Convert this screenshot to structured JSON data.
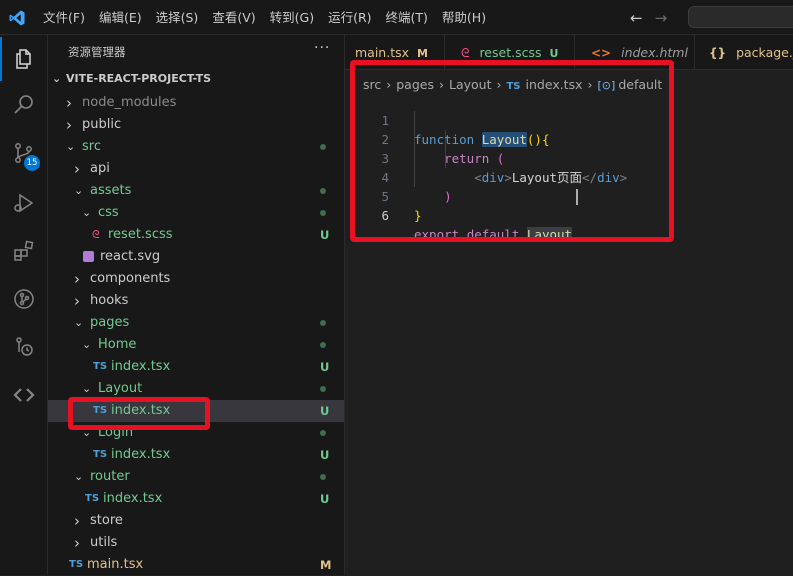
{
  "titlebar": {
    "menu": [
      "文件(F)",
      "编辑(E)",
      "选择(S)",
      "查看(V)",
      "转到(G)",
      "运行(R)",
      "终端(T)",
      "帮助(H)"
    ]
  },
  "activity": {
    "scm_badge": "15"
  },
  "sidebar": {
    "title": "资源管理器",
    "more": "···",
    "project": "VITE-REACT-PROJECT-TS",
    "tree": [
      {
        "name": "node_modules",
        "type": "folder",
        "expanded": false,
        "color": "#8b8b8b"
      },
      {
        "name": "public",
        "type": "folder",
        "expanded": false,
        "color": "#cccccc"
      },
      {
        "name": "src",
        "type": "folder",
        "expanded": true,
        "color": "#73c991"
      },
      {
        "name": "api",
        "type": "folder",
        "expanded": false,
        "color": "#cccccc"
      },
      {
        "name": "assets",
        "type": "folder",
        "expanded": true,
        "color": "#73c991"
      },
      {
        "name": "css",
        "type": "folder",
        "expanded": true,
        "color": "#73c991"
      },
      {
        "name": "reset.scss",
        "type": "scss",
        "color": "#73c991",
        "status": "U"
      },
      {
        "name": "react.svg",
        "type": "svg",
        "color": "#cccccc"
      },
      {
        "name": "components",
        "type": "folder",
        "expanded": false,
        "color": "#cccccc"
      },
      {
        "name": "hooks",
        "type": "folder",
        "expanded": false,
        "color": "#cccccc"
      },
      {
        "name": "pages",
        "type": "folder",
        "expanded": true,
        "color": "#73c991"
      },
      {
        "name": "Home",
        "type": "folder",
        "expanded": true,
        "color": "#73c991"
      },
      {
        "name": "index.tsx",
        "type": "ts",
        "color": "#73c991",
        "status": "U"
      },
      {
        "name": "Layout",
        "type": "folder",
        "expanded": true,
        "color": "#73c991"
      },
      {
        "name": "index.tsx",
        "type": "ts",
        "color": "#73c991",
        "status": "U",
        "selected": true
      },
      {
        "name": "Login",
        "type": "folder",
        "expanded": true,
        "color": "#73c991"
      },
      {
        "name": "index.tsx",
        "type": "ts",
        "color": "#73c991",
        "status": "U"
      },
      {
        "name": "router",
        "type": "folder",
        "expanded": true,
        "color": "#73c991"
      },
      {
        "name": "index.tsx",
        "type": "ts",
        "color": "#73c991",
        "status": "U"
      },
      {
        "name": "store",
        "type": "folder",
        "expanded": false,
        "color": "#cccccc"
      },
      {
        "name": "utils",
        "type": "folder",
        "expanded": false,
        "color": "#cccccc"
      },
      {
        "name": "main.tsx",
        "type": "ts",
        "color": "#e2c08d",
        "status": "M"
      }
    ]
  },
  "tabs": [
    {
      "label": "main.tsx",
      "status": "M",
      "icon": "ts-icon",
      "status_color": "#e2c08d",
      "label_color": "#e2c08d"
    },
    {
      "label": "reset.scss",
      "status": "U",
      "icon": "scss-icon",
      "status_color": "#73c991",
      "label_color": "#73c991"
    },
    {
      "label": "index.html",
      "icon": "html-icon",
      "label_color": "#9d9d9d"
    },
    {
      "label": "package.json",
      "icon": "json-icon",
      "label_color": "#e2c08d"
    }
  ],
  "breadcrumb": {
    "parts": [
      "src",
      "pages",
      "Layout"
    ],
    "file_icon": "TS",
    "file": "index.tsx",
    "symbol": "default"
  },
  "code": {
    "line_numbers": [
      "1",
      "2",
      "3",
      "4",
      "5",
      "6"
    ],
    "l1_kw": "function",
    "l1_name": "Layout",
    "l1_rest": "(){",
    "l2_kw": "return",
    "l2_paren": "(",
    "l3_open": "div",
    "l3_text": "Layout页面",
    "l3_close": "div",
    "l4_paren": ")",
    "l5_brace": "}",
    "l6_kw1": "export",
    "l6_kw2": "default",
    "l6_name": "Layout"
  }
}
